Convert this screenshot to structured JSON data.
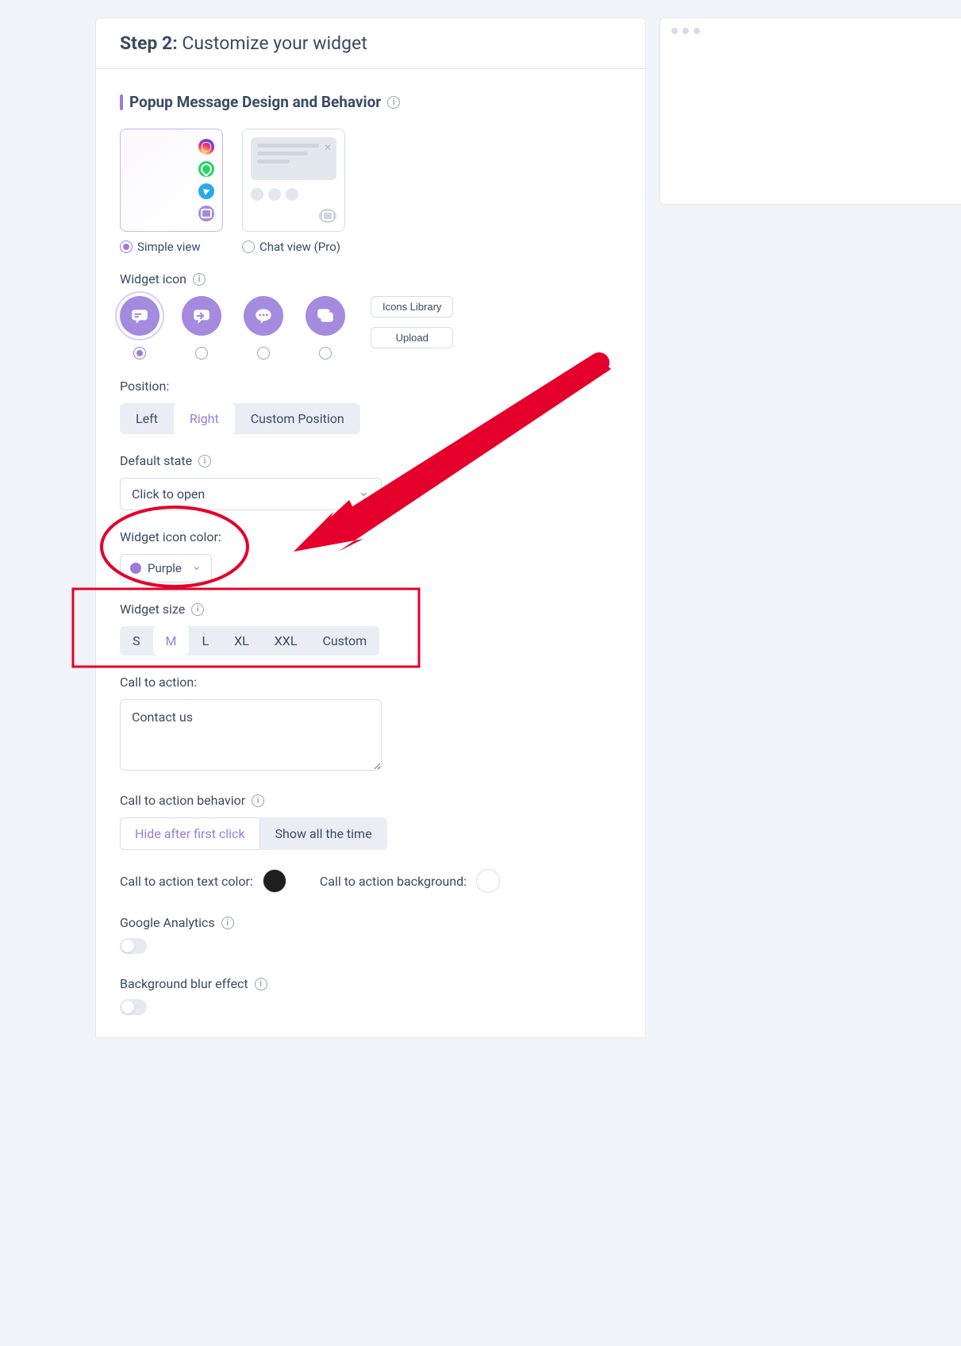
{
  "step": {
    "prefix": "Step 2:",
    "title": " Customize your widget"
  },
  "section": {
    "title": "Popup Message Design and Behavior"
  },
  "view": {
    "simple_label": "Simple view",
    "chat_label": "Chat view (Pro)"
  },
  "widget_icon": {
    "label": "Widget icon",
    "buttons": {
      "library": "Icons Library",
      "upload": "Upload"
    }
  },
  "position": {
    "label": "Position:",
    "options": {
      "left": "Left",
      "right": "Right",
      "custom": "Custom Position"
    }
  },
  "default_state": {
    "label": "Default state",
    "value": "Click to open"
  },
  "icon_color": {
    "label": "Widget icon color:",
    "value": "Purple",
    "hex": "#9b7cdd"
  },
  "widget_size": {
    "label": "Widget size",
    "options": {
      "s": "S",
      "m": "M",
      "l": "L",
      "xl": "XL",
      "xxl": "XXL",
      "custom": "Custom"
    }
  },
  "cta": {
    "label": "Call to action:",
    "value": "Contact us"
  },
  "cta_behavior": {
    "label": "Call to action behavior",
    "hide": "Hide after first click",
    "show": "Show all the time"
  },
  "cta_colors": {
    "text_label": "Call to action text color:",
    "bg_label": "Call to action background:",
    "text_hex": "#1e1e1e",
    "bg_hex": "#ffffff"
  },
  "ga": {
    "label": "Google Analytics"
  },
  "blur": {
    "label": "Background blur effect"
  }
}
